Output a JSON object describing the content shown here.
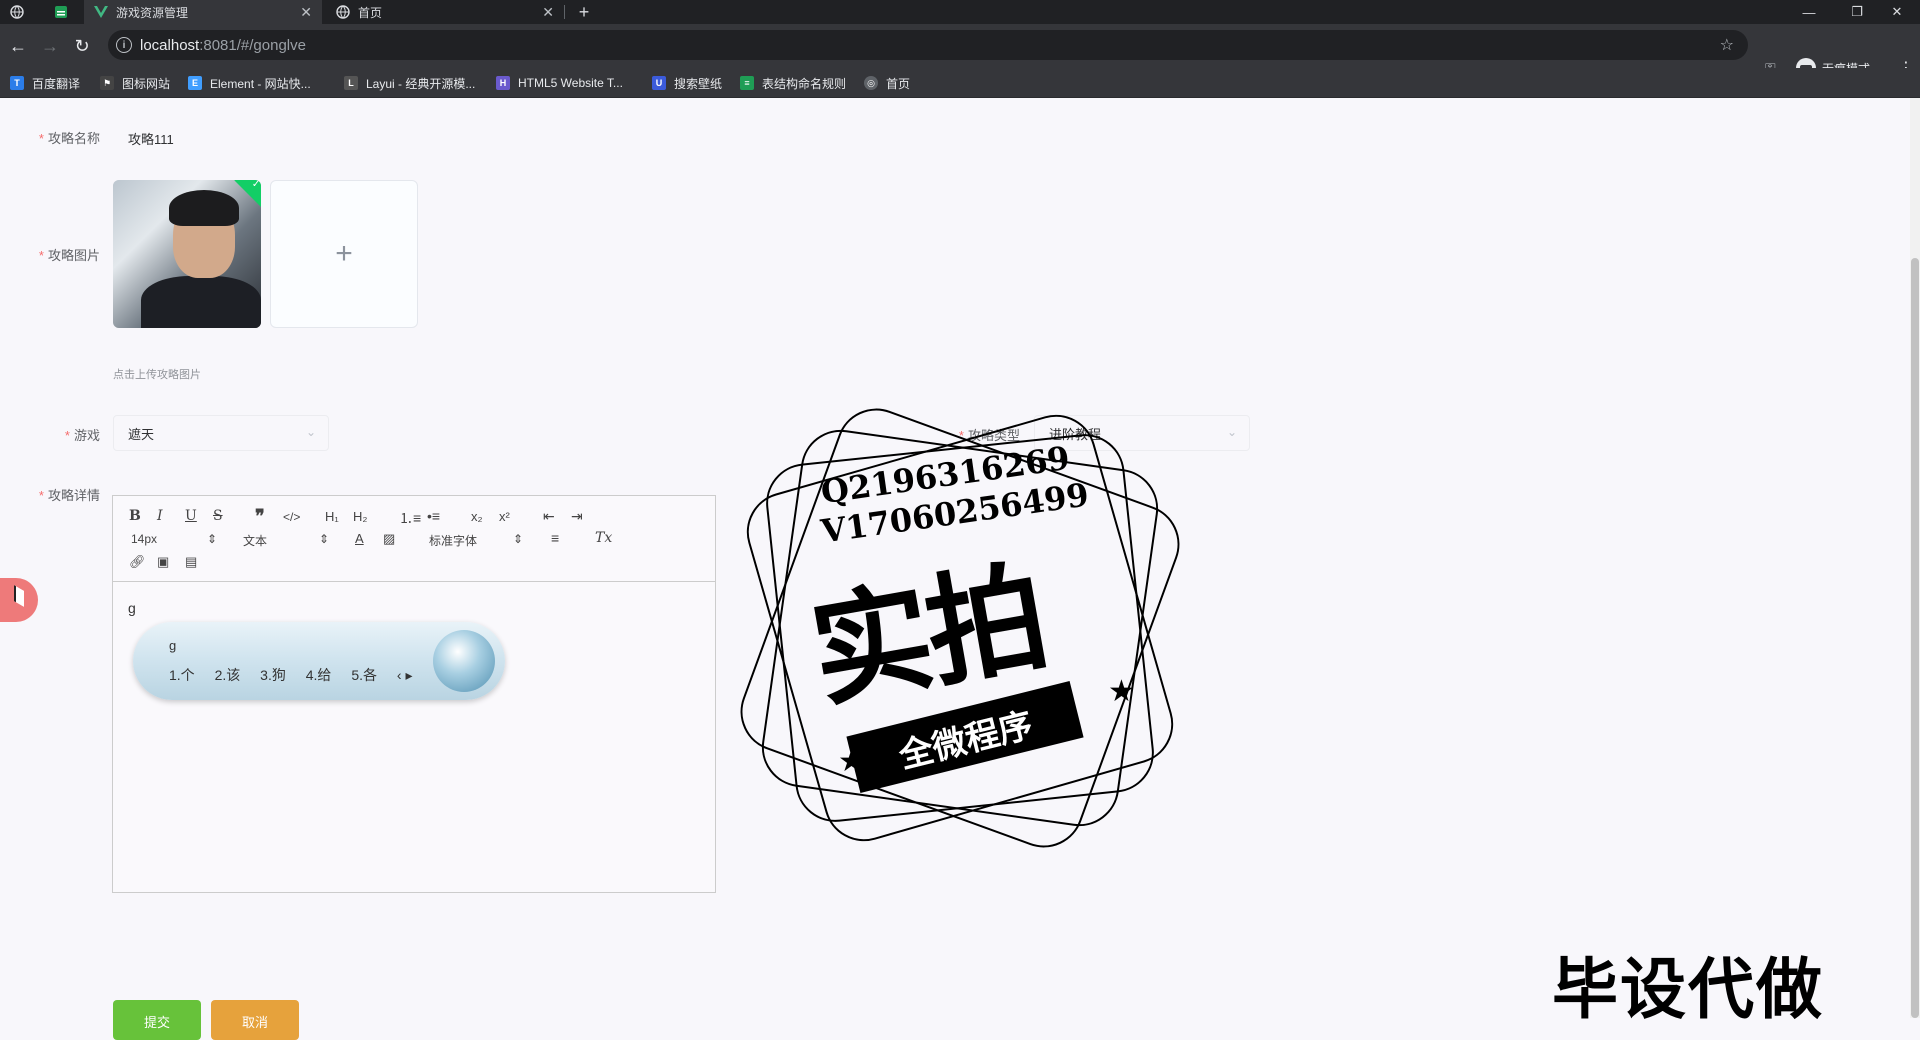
{
  "browser": {
    "tabs": [
      {
        "title": ""
      },
      {
        "title": ""
      },
      {
        "title": "游戏资源管理"
      },
      {
        "title": "首页"
      }
    ],
    "url_host": "localhost",
    "url_rest": ":8081/#/gonglve",
    "profile_label": "无痕模式",
    "bookmarks": [
      "百度翻译",
      "图标网站",
      "Element - 网站快...",
      "Layui - 经典开源模...",
      "HTML5 Website T...",
      "搜索壁纸",
      "表结构命名规则",
      "首页"
    ]
  },
  "form": {
    "name_label": "攻略名称",
    "name_value": "攻略111",
    "image_label": "攻略图片",
    "upload_plus": "+",
    "upload_tip": "点击上传攻略图片",
    "game_label": "游戏",
    "game_value": "遮天",
    "type_label": "攻略类型",
    "type_value": "进阶教程",
    "detail_label": "攻略详情",
    "submit_label": "提交",
    "cancel_label": "取消"
  },
  "editor": {
    "font_size": "14px",
    "block_type": "文本",
    "font_family": "标准字体",
    "content": "g",
    "ime_composition": "g",
    "ime_candidates": [
      "1.个",
      "2.该",
      "3.狗",
      "4.给",
      "5.各"
    ]
  },
  "watermark": {
    "qq": "Q2196316269",
    "vx": "V17060256499",
    "main": "实拍",
    "ribbon": "全微程序",
    "corner": "毕设代做"
  }
}
